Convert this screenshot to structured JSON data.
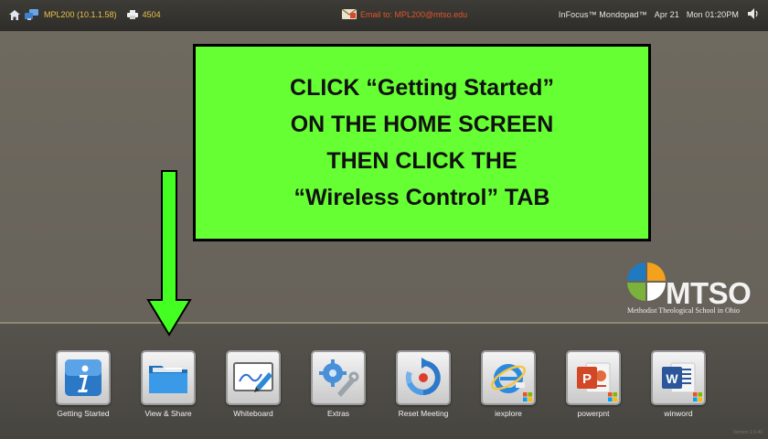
{
  "topbar": {
    "device": "MPL200 (10.1.1.58)",
    "printer_count": "4504",
    "email": "Email to: MPL200@mtso.edu",
    "product": "InFocus™ Mondopad™",
    "date": "Apr 21",
    "time": "Mon 01:20PM"
  },
  "callout": {
    "lines": [
      "CLICK “Getting Started”",
      "ON THE HOME SCREEN",
      "THEN CLICK THE",
      "“Wireless Control” TAB"
    ]
  },
  "logo": {
    "wordmark": "MTSO",
    "tagline": "Methodist Theological School in Ohio",
    "colors": [
      "#1f7ac1",
      "#f4a11c",
      "#7ab23c",
      "#ffffff"
    ]
  },
  "dock": {
    "apps": [
      {
        "label": "Getting Started",
        "icon": "info-icon"
      },
      {
        "label": "View & Share",
        "icon": "folder-icon"
      },
      {
        "label": "Whiteboard",
        "icon": "whiteboard-icon"
      },
      {
        "label": "Extras",
        "icon": "tools-icon"
      },
      {
        "label": "Reset Meeting",
        "icon": "reset-icon"
      },
      {
        "label": "iexplore",
        "icon": "internet-explorer-icon"
      },
      {
        "label": "powerpnt",
        "icon": "powerpoint-icon"
      },
      {
        "label": "winword",
        "icon": "word-icon"
      }
    ],
    "version": "Version 1.0.40"
  },
  "colors": {
    "callout_bg": "#66ff33",
    "arrow": "#44ff22",
    "topbar_text": "#e8c14a"
  }
}
